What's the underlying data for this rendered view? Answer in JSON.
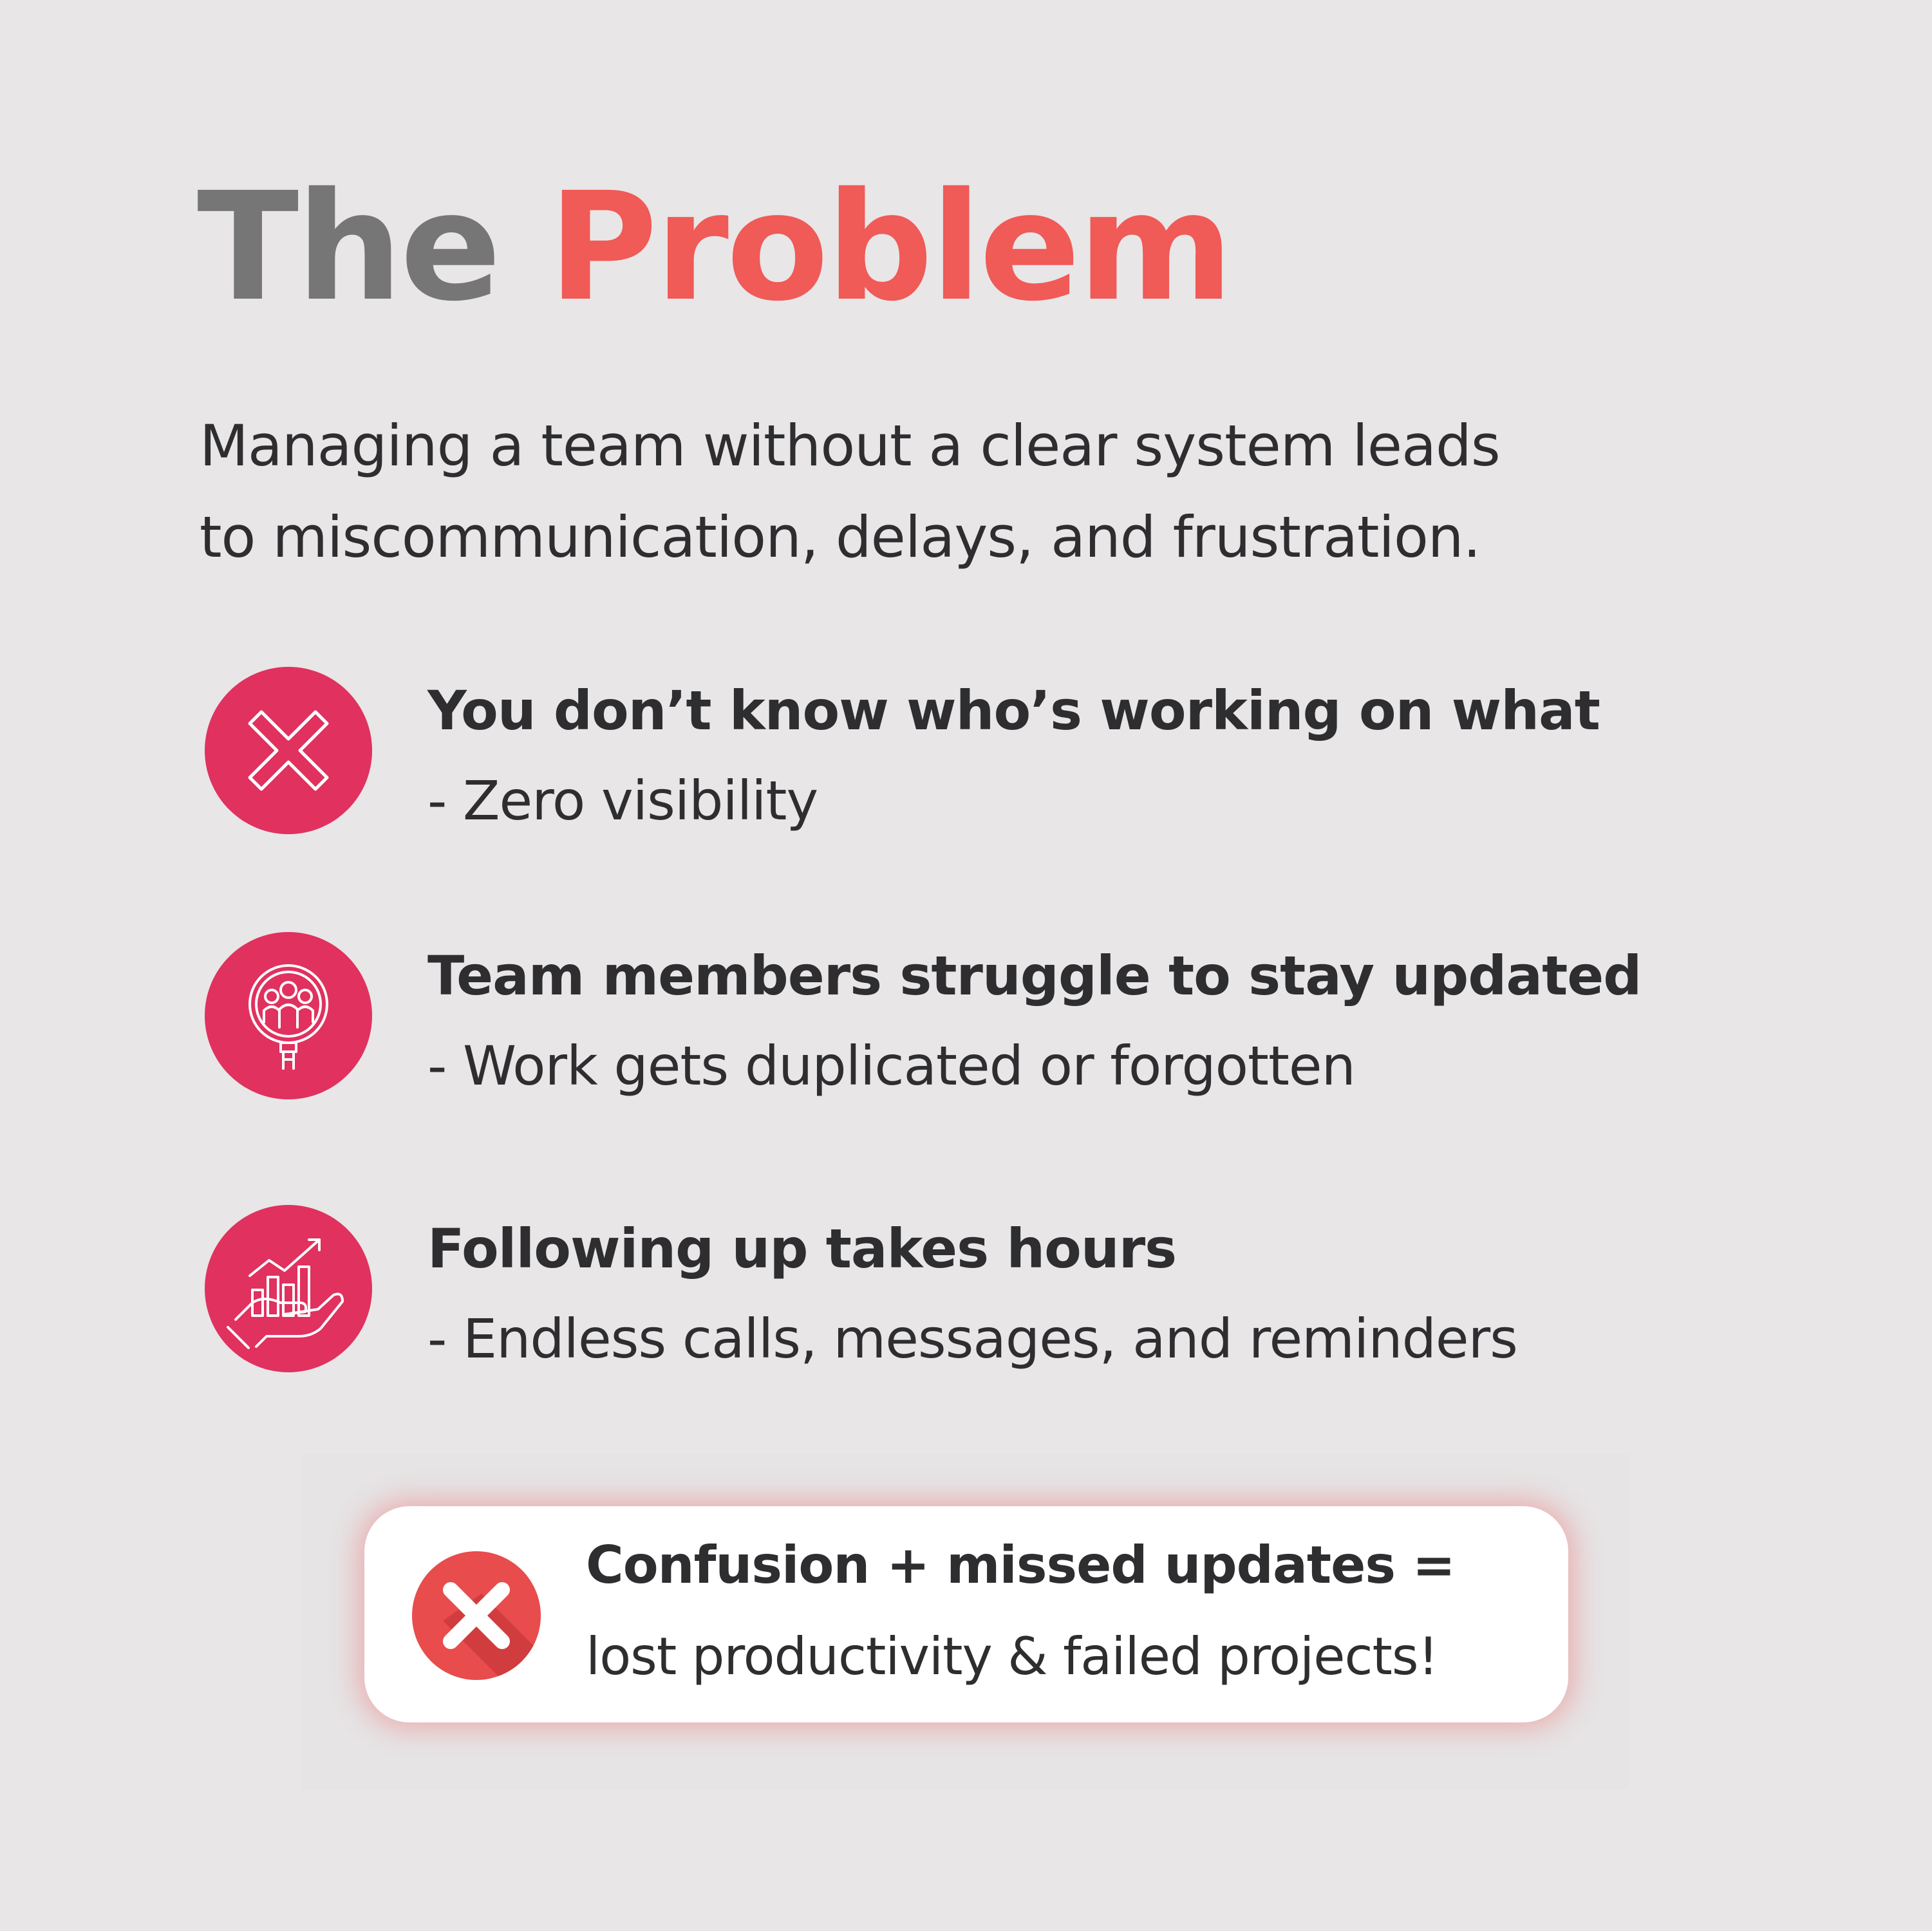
{
  "header": {
    "title_word_1": "The",
    "title_word_2": "Problem"
  },
  "intro": {
    "line_1": "Managing a team without a clear system leads",
    "line_2": "to miscommunication, delays, and frustration."
  },
  "problems": [
    {
      "icon": "cross-mark-icon",
      "title": "You don’t know who’s working on what",
      "detail": "- Zero visibility"
    },
    {
      "icon": "team-magnifier-icon",
      "title": "Team members struggle to stay updated",
      "detail": "- Work gets duplicated or forgotten"
    },
    {
      "icon": "hand-growth-chart-icon",
      "title": "Following up takes hours",
      "detail": "- Endless calls, messages, and reminders"
    }
  ],
  "callout": {
    "icon": "red-x-circle-icon",
    "line_1": "Confusion + missed updates =",
    "line_2": "lost productivity & failed projects!"
  },
  "colors": {
    "background": "#e8e6e7",
    "title_gray": "#767676",
    "title_accent": "#f05a57",
    "icon_circle": "#e0315f",
    "text": "#2e2e30",
    "callout_glow": "#f06e6e"
  }
}
